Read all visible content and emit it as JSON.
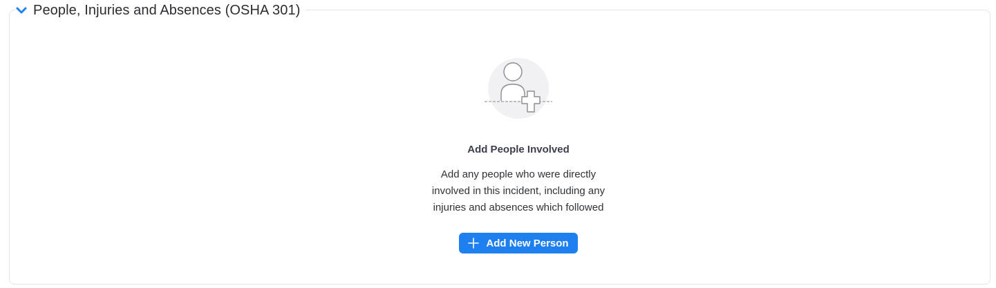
{
  "section": {
    "title": "People, Injuries and Absences (OSHA 301)",
    "expand_icon": "chevron-down-icon"
  },
  "empty_state": {
    "illustration_icon": "add-person-icon",
    "title": "Add People Involved",
    "description_lines": [
      "Add any people who were directly",
      "involved in this incident, including any",
      "injuries and absences which followed"
    ]
  },
  "actions": {
    "add_person_label": "Add New Person",
    "add_icon": "plus-icon"
  },
  "colors": {
    "accent": "#1d7ff0",
    "text": "#2b2b33",
    "border": "#e6e6e9"
  }
}
